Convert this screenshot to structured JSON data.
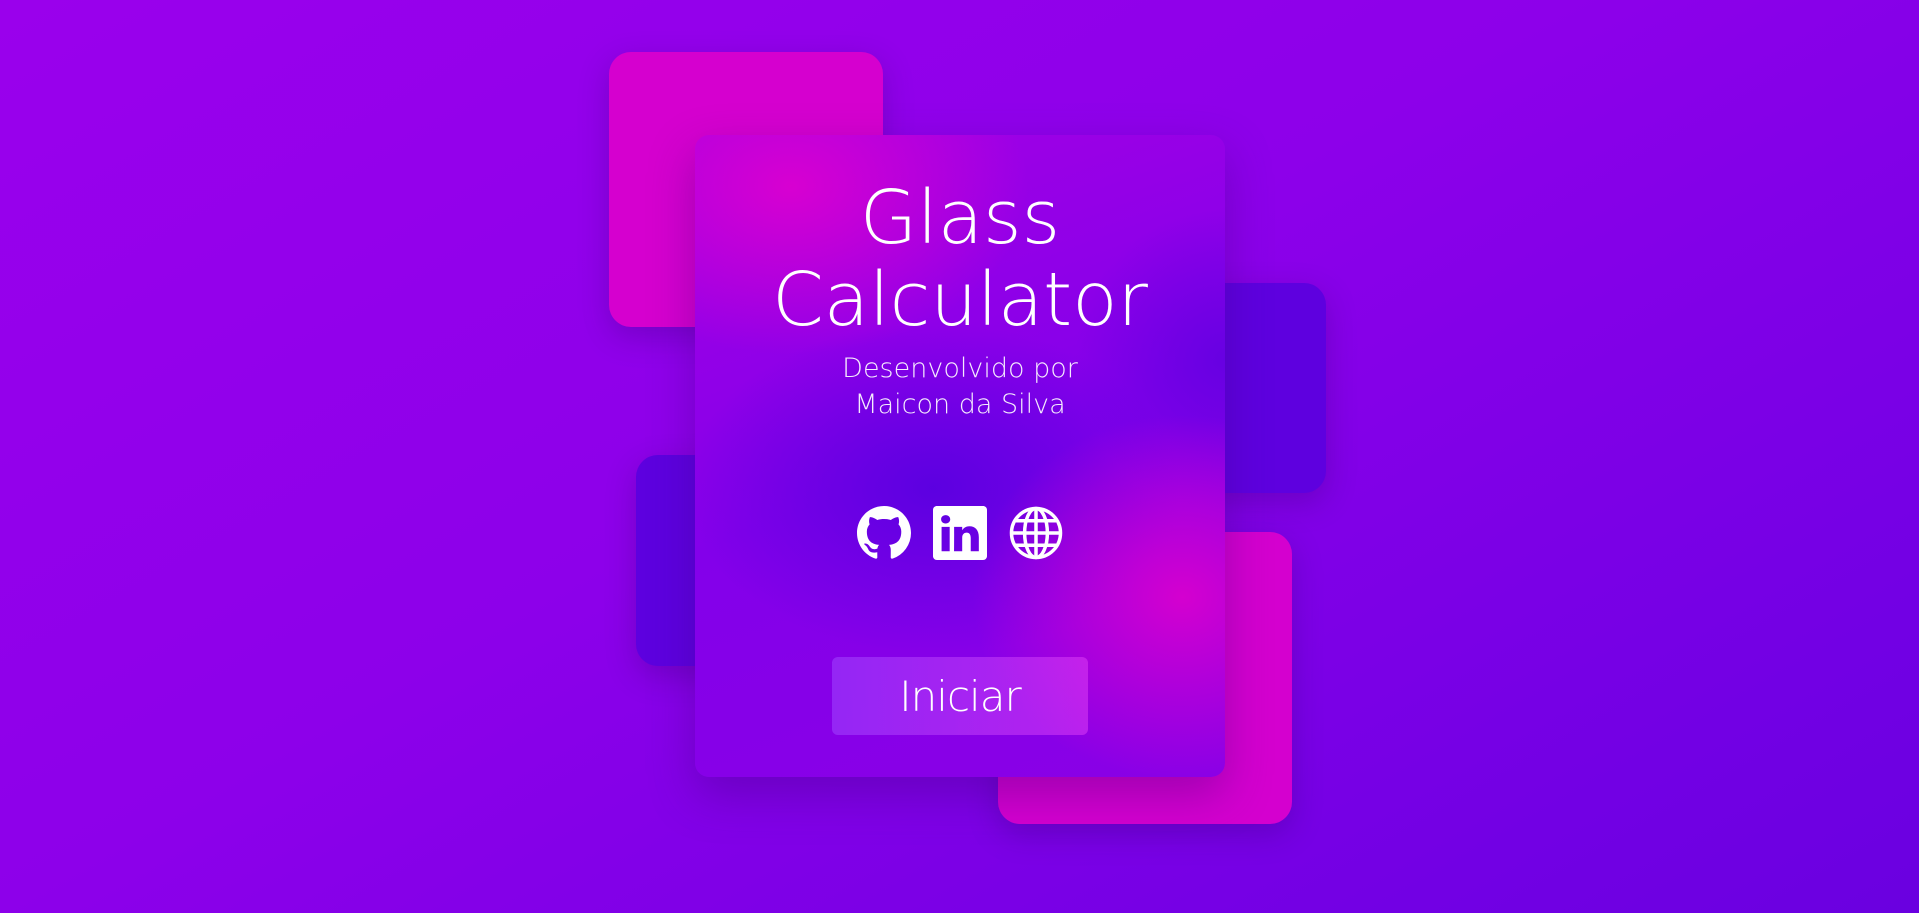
{
  "app": {
    "title_line1": "Glass",
    "title_line2": "Calculator",
    "subtitle_line1": "Desenvolvido por",
    "subtitle_line2": "Maicon da Silva"
  },
  "social_links": [
    {
      "icon": "github-icon"
    },
    {
      "icon": "linkedin-icon"
    },
    {
      "icon": "globe-icon"
    }
  ],
  "actions": {
    "start_label": "Iniciar"
  },
  "colors": {
    "background": "#8d00ea",
    "accent_pink": "#d500cf",
    "accent_blue": "#5d00df",
    "text": "#ffffff"
  }
}
